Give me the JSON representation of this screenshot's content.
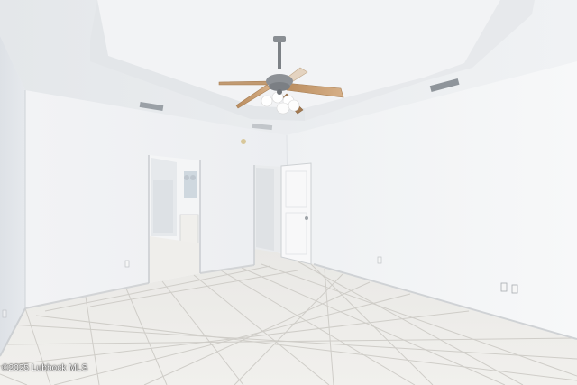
{
  "photo": {
    "watermark": "©2025 Lubbock MLS"
  }
}
